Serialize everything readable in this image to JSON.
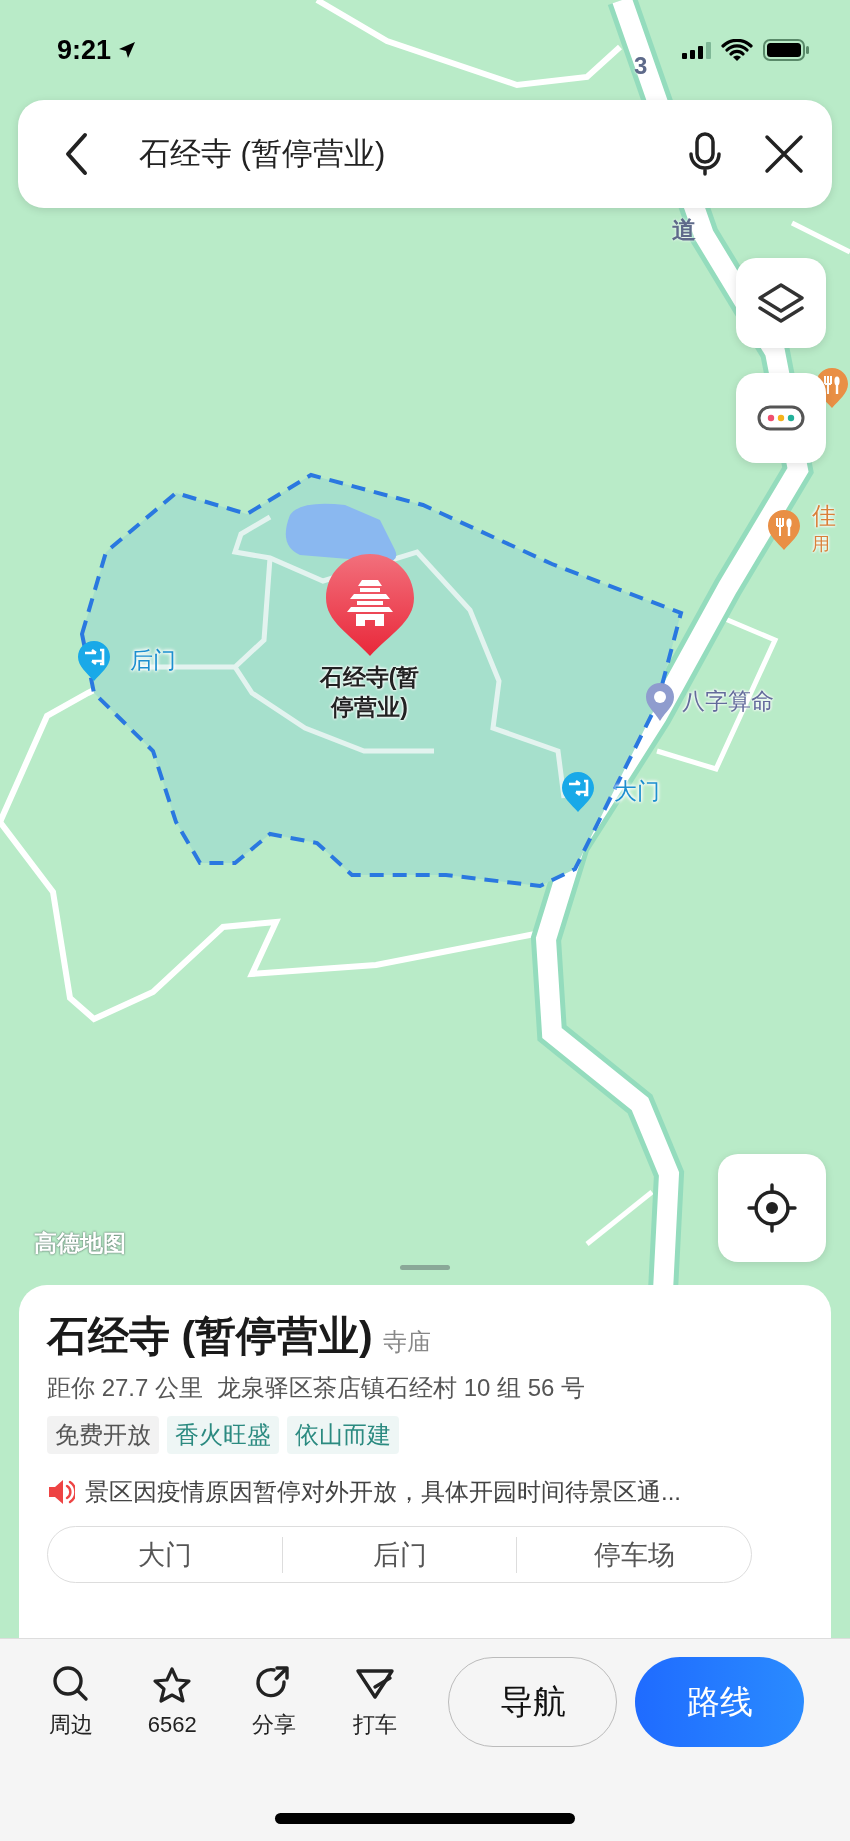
{
  "status_bar": {
    "time": "9:21"
  },
  "search_bar": {
    "query": "石经寺 (暂停营业)"
  },
  "map": {
    "road_labels": [
      "3",
      "道"
    ],
    "pois": [
      {
        "kind": "temple",
        "label": "石经寺(暂停营业)"
      },
      {
        "kind": "gate",
        "label": "后门"
      },
      {
        "kind": "gate",
        "label": "大门"
      },
      {
        "kind": "place",
        "label": "八字算命"
      },
      {
        "kind": "restaurant",
        "label": "佳",
        "sublabel": "用"
      },
      {
        "kind": "restaurant"
      }
    ],
    "logo": "高德地图"
  },
  "place_card": {
    "title": "石经寺 (暂停营业)",
    "category": "寺庙",
    "distance": "距你 27.7 公里",
    "address": "龙泉驿区茶店镇石经村 10 组 56 号",
    "tags": [
      {
        "label": "免费开放",
        "color": "#555555"
      },
      {
        "label": "香火旺盛",
        "color": "#2b8a80"
      },
      {
        "label": "依山而建",
        "color": "#2b8a80"
      }
    ],
    "notice": "景区因疫情原因暂停对外开放，具体开园时间待景区通...",
    "entrances": [
      "大门",
      "后门",
      "停车场"
    ]
  },
  "actions": [
    {
      "kind": "nearby",
      "label": "周边"
    },
    {
      "kind": "favorite",
      "label": "6562"
    },
    {
      "kind": "share",
      "label": "分享"
    },
    {
      "kind": "taxi",
      "label": "打车"
    }
  ],
  "buttons": [
    {
      "kind": "secondary",
      "label": "导航"
    },
    {
      "kind": "primary",
      "label": "路线"
    }
  ]
}
